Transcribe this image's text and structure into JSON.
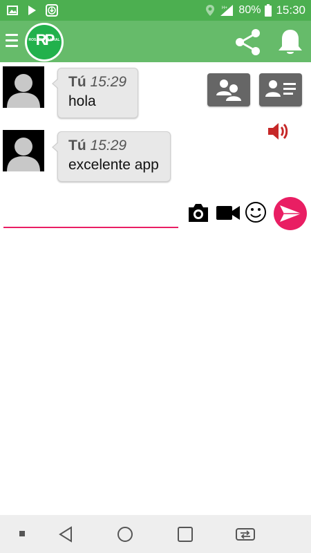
{
  "status_bar": {
    "battery_percent": "80%",
    "time": "15:30",
    "icons": [
      "image-icon",
      "play-icon",
      "download-icon",
      "location-icon",
      "signal-icon",
      "battery-icon"
    ]
  },
  "app_bar": {
    "logo_text": "RP",
    "logo_subtext": "ROSARIO PLURAL",
    "icons": [
      "menu-icon",
      "share-icon",
      "bell-icon"
    ]
  },
  "messages": [
    {
      "sender": "Tú",
      "time": "15:29",
      "text": "hola"
    },
    {
      "sender": "Tú",
      "time": "15:29",
      "text": "excelente app"
    }
  ],
  "actions": {
    "icons": [
      "group-icon",
      "contact-card-icon",
      "speaker-icon"
    ]
  },
  "composer": {
    "input_value": "",
    "icons": [
      "camera-icon",
      "video-icon",
      "emoji-icon",
      "send-icon"
    ]
  },
  "nav_bar": {
    "icons": [
      "menu-dot-icon",
      "back-icon",
      "home-icon",
      "recents-icon",
      "switch-app-icon"
    ]
  },
  "colors": {
    "status_bar": "#4caf50",
    "app_bar": "#66bb6a",
    "accent": "#e91e63",
    "bubble": "#e8e8e8",
    "speaker": "#c62828"
  }
}
